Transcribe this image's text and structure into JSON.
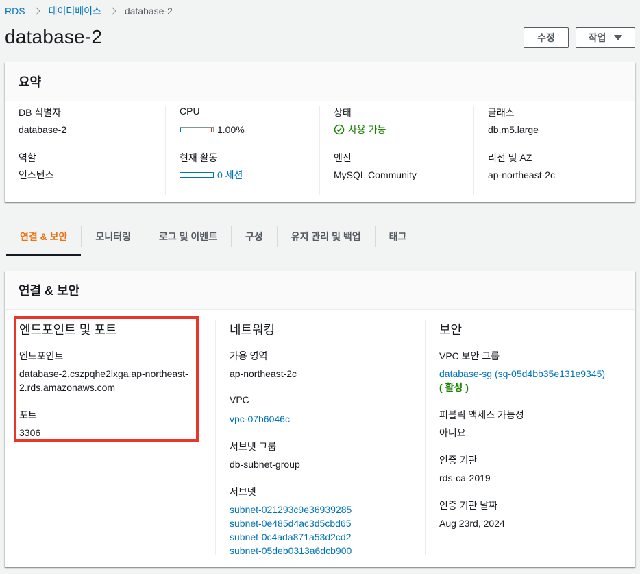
{
  "breadcrumb": {
    "items": [
      "RDS",
      "데이터베이스"
    ],
    "current": "database-2"
  },
  "header": {
    "title": "database-2",
    "edit_label": "수정",
    "actions_label": "작업"
  },
  "summary": {
    "title": "요약",
    "db_id_label": "DB 식별자",
    "db_id_value": "database-2",
    "role_label": "역할",
    "role_value": "인스턴스",
    "cpu_label": "CPU",
    "cpu_value": "1.00%",
    "cpu_percent": 1.0,
    "activity_label": "현재 활동",
    "activity_value": "0 세션",
    "status_label": "상태",
    "status_value": "사용 가능",
    "engine_label": "엔진",
    "engine_value": "MySQL Community",
    "class_label": "클래스",
    "class_value": "db.m5.large",
    "region_label": "리전 및 AZ",
    "region_value": "ap-northeast-2c"
  },
  "tabs": [
    {
      "label": "연결 & 보안",
      "active": true
    },
    {
      "label": "모니터링",
      "active": false
    },
    {
      "label": "로그 및 이벤트",
      "active": false
    },
    {
      "label": "구성",
      "active": false
    },
    {
      "label": "유지 관리 및 백업",
      "active": false
    },
    {
      "label": "태그",
      "active": false
    }
  ],
  "connectivity": {
    "title": "연결 & 보안",
    "endpoint_section": {
      "title": "엔드포인트 및 포트",
      "endpoint_label": "엔드포인트",
      "endpoint_line1": "database-2.cszpqhe2lxga.ap-northeast-",
      "endpoint_line2": "2.rds.amazonaws.com",
      "port_label": "포트",
      "port_value": "3306"
    },
    "network_section": {
      "title": "네트워킹",
      "az_label": "가용 영역",
      "az_value": "ap-northeast-2c",
      "vpc_label": "VPC",
      "vpc_value": "vpc-07b6046c",
      "subnet_group_label": "서브넷 그룹",
      "subnet_group_value": "db-subnet-group",
      "subnets_label": "서브넷",
      "subnets": [
        "subnet-021293c9e36939285",
        "subnet-0e485d4ac3d5cbd65",
        "subnet-0c4ada871a53d2cd2",
        "subnet-05deb0313a6dcb900"
      ]
    },
    "security_section": {
      "title": "보안",
      "sg_label": "VPC 보안 그룹",
      "sg_value": "database-sg (sg-05d4bb35e131e9345)",
      "sg_status": "( 활성 )",
      "public_label": "퍼블릭 액세스 가능성",
      "public_value": "아니요",
      "ca_label": "인증 기관",
      "ca_value": "rds-ca-2019",
      "ca_date_label": "인증 기관 날짜",
      "ca_date_value": "Aug 23rd, 2024"
    }
  },
  "colors": {
    "link": "#0073bb",
    "active_tab": "#ec7211",
    "success": "#1d8102",
    "highlight": "#e8362a"
  }
}
